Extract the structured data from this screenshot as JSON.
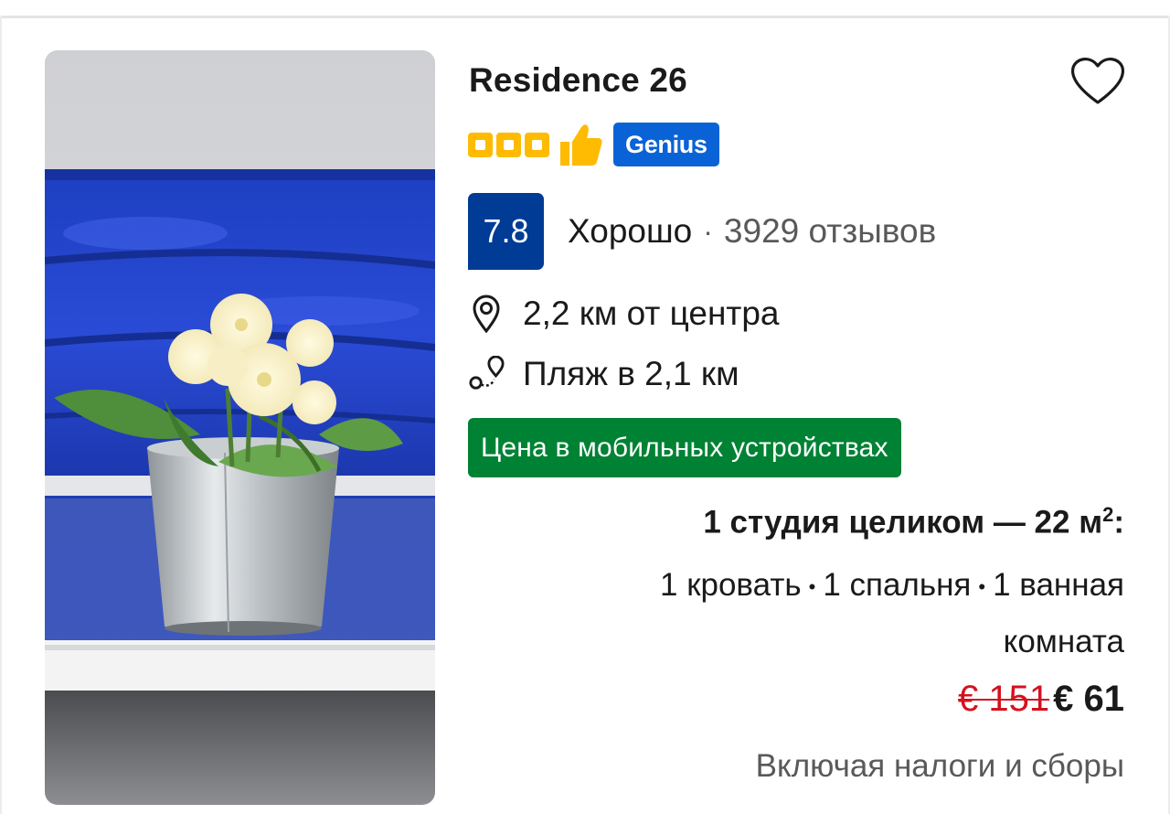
{
  "hotel": {
    "name": "Residence 26",
    "stars": 3,
    "genius_label": "Genius",
    "favorite_icon": "heart-outline-icon"
  },
  "rating": {
    "score": "7.8",
    "word": "Хорошо",
    "separator": "·",
    "reviews": "3929 отзывов"
  },
  "location": {
    "distance_center": "2,2 км от центра",
    "beach": "Пляж в 2,1 км"
  },
  "deal_badge": "Цена в мобильных устройствах",
  "unit": {
    "title": "1 студия целиком — 22 м",
    "title_sup": "2",
    "title_suffix": ":",
    "beds": "1 кровать",
    "bedrooms": "1 спальня",
    "bath_line1": "1 ванная",
    "bath_line2": "комната",
    "bullet": "•"
  },
  "price": {
    "old": "€ 151",
    "new": "€ 61",
    "taxes_note": "Включая налоги и сборы"
  },
  "colors": {
    "star": "#febb02",
    "genius": "#0a63d6",
    "score_bg": "#003b95",
    "deal_green": "#008234",
    "old_price_red": "#d4111e"
  }
}
